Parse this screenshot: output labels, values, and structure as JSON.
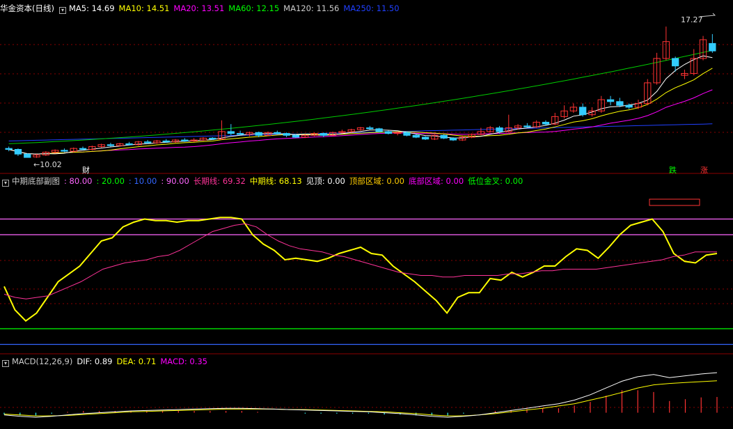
{
  "stock_title": "华金资本(日线)",
  "legend_ma": [
    {
      "label": "MA5: 14.69",
      "color": "#ffffff"
    },
    {
      "label": "MA10: 14.51",
      "color": "#ffff00"
    },
    {
      "label": "MA20: 13.51",
      "color": "#ff00ff"
    },
    {
      "label": "MA60: 12.15",
      "color": "#00ff00"
    },
    {
      "label": "MA120: 11.56",
      "color": "#cccccc"
    },
    {
      "label": "MA250: 11.50",
      "color": "#2040ff"
    }
  ],
  "price_high_label": "17.27",
  "price_low_label": "←10.02",
  "marker_cai": "财",
  "marker_die": "跌",
  "marker_zhang": "涨",
  "legend_mid": [
    {
      "label": "中期底部副图",
      "color": "#cccccc"
    },
    {
      "label": ": 80.00",
      "color": "#ff66ff"
    },
    {
      "label": ": 20.00",
      "color": "#00ff00"
    },
    {
      "label": ": 10.00",
      "color": "#3366ff"
    },
    {
      "label": ": 90.00",
      "color": "#ff66ff"
    },
    {
      "label": "长期线: 69.32",
      "color": "#ff3399"
    },
    {
      "label": "中期线: 68.13",
      "color": "#ffff00"
    },
    {
      "label": "见顶: 0.00",
      "color": "#ffffff"
    },
    {
      "label": "顶部区域: 0.00",
      "color": "#ffcc00"
    },
    {
      "label": "底部区域: 0.00",
      "color": "#ff00ff"
    },
    {
      "label": "低位金叉: 0.00",
      "color": "#00ff00"
    }
  ],
  "legend_macd": [
    {
      "label": "MACD(12,26,9)",
      "color": "#cccccc"
    },
    {
      "label": "DIF: 0.89",
      "color": "#ffffff"
    },
    {
      "label": "DEA: 0.71",
      "color": "#ffff00"
    },
    {
      "label": "MACD: 0.35",
      "color": "#ff00ff"
    }
  ],
  "colors": {
    "up": "#ff3333",
    "down": "#33ccff",
    "grid": "#8b0000"
  },
  "chart_data": [
    {
      "type": "candlestick",
      "title": "华金资本(日线)",
      "ylim": [
        9.8,
        17.6
      ],
      "candles": [
        [
          10.5,
          10.45,
          10.6,
          10.35
        ],
        [
          10.45,
          10.2,
          10.5,
          10.1
        ],
        [
          10.2,
          10.02,
          10.25,
          10.02
        ],
        [
          10.05,
          10.15,
          10.2,
          10.0
        ],
        [
          10.15,
          10.3,
          10.35,
          10.1
        ],
        [
          10.3,
          10.4,
          10.45,
          10.25
        ],
        [
          10.4,
          10.35,
          10.5,
          10.3
        ],
        [
          10.35,
          10.5,
          10.55,
          10.3
        ],
        [
          10.5,
          10.45,
          10.6,
          10.4
        ],
        [
          10.45,
          10.6,
          10.65,
          10.4
        ],
        [
          10.6,
          10.7,
          10.75,
          10.55
        ],
        [
          10.7,
          10.65,
          10.8,
          10.6
        ],
        [
          10.65,
          10.75,
          10.8,
          10.6
        ],
        [
          10.75,
          10.7,
          10.85,
          10.65
        ],
        [
          10.7,
          10.85,
          10.9,
          10.65
        ],
        [
          10.85,
          10.8,
          10.95,
          10.75
        ],
        [
          10.8,
          10.9,
          10.95,
          10.75
        ],
        [
          10.9,
          10.85,
          11.0,
          10.8
        ],
        [
          10.85,
          10.95,
          11.0,
          10.8
        ],
        [
          10.95,
          10.9,
          11.05,
          10.85
        ],
        [
          10.9,
          10.95,
          11.05,
          10.85
        ],
        [
          10.95,
          11.05,
          11.1,
          10.9
        ],
        [
          11.05,
          11.0,
          11.1,
          10.95
        ],
        [
          11.0,
          11.4,
          12.0,
          10.95
        ],
        [
          11.4,
          11.3,
          11.8,
          11.2
        ],
        [
          11.3,
          11.25,
          11.45,
          11.2
        ],
        [
          11.25,
          11.35,
          11.4,
          11.15
        ],
        [
          11.35,
          11.2,
          11.4,
          11.1
        ],
        [
          11.2,
          11.35,
          11.4,
          11.15
        ],
        [
          11.35,
          11.3,
          11.45,
          11.25
        ],
        [
          11.3,
          11.2,
          11.35,
          11.1
        ],
        [
          11.2,
          11.1,
          11.25,
          11.05
        ],
        [
          11.1,
          11.2,
          11.25,
          11.05
        ],
        [
          11.2,
          11.3,
          11.35,
          11.15
        ],
        [
          11.3,
          11.2,
          11.35,
          11.1
        ],
        [
          11.2,
          11.35,
          11.4,
          11.15
        ],
        [
          11.35,
          11.4,
          11.5,
          11.3
        ],
        [
          11.4,
          11.5,
          11.55,
          11.35
        ],
        [
          11.5,
          11.6,
          11.65,
          11.45
        ],
        [
          11.6,
          11.55,
          11.7,
          11.5
        ],
        [
          11.55,
          11.4,
          11.6,
          11.35
        ],
        [
          11.4,
          11.3,
          11.45,
          11.25
        ],
        [
          11.3,
          11.35,
          11.4,
          11.2
        ],
        [
          11.35,
          11.2,
          11.4,
          11.15
        ],
        [
          11.2,
          11.1,
          11.25,
          11.05
        ],
        [
          11.1,
          11.0,
          11.15,
          10.95
        ],
        [
          11.0,
          11.2,
          11.25,
          10.95
        ],
        [
          11.2,
          11.05,
          11.25,
          11.0
        ],
        [
          11.05,
          10.95,
          11.1,
          10.9
        ],
        [
          10.95,
          11.1,
          11.2,
          10.9
        ],
        [
          11.1,
          11.25,
          11.3,
          11.05
        ],
        [
          11.25,
          11.4,
          11.6,
          11.2
        ],
        [
          11.4,
          11.6,
          11.7,
          11.35
        ],
        [
          11.6,
          11.4,
          11.7,
          11.3
        ],
        [
          11.4,
          11.6,
          12.3,
          11.35
        ],
        [
          11.6,
          11.7,
          11.8,
          11.5
        ],
        [
          11.7,
          11.65,
          11.85,
          11.6
        ],
        [
          11.65,
          11.9,
          12.0,
          11.6
        ],
        [
          11.9,
          11.8,
          12.0,
          11.7
        ],
        [
          11.8,
          12.2,
          12.4,
          11.75
        ],
        [
          12.2,
          12.5,
          12.8,
          12.1
        ],
        [
          12.5,
          12.7,
          12.9,
          12.4
        ],
        [
          12.7,
          12.3,
          12.9,
          12.2
        ],
        [
          12.3,
          12.5,
          12.7,
          12.2
        ],
        [
          12.5,
          13.1,
          13.3,
          12.4
        ],
        [
          13.1,
          13.0,
          13.3,
          12.8
        ],
        [
          13.0,
          12.8,
          13.2,
          12.7
        ],
        [
          12.8,
          12.7,
          12.9,
          12.6
        ],
        [
          12.7,
          12.9,
          13.1,
          12.6
        ],
        [
          12.9,
          14.0,
          14.2,
          12.8
        ],
        [
          14.0,
          15.3,
          15.6,
          13.9
        ],
        [
          15.3,
          16.2,
          17.0,
          15.2
        ],
        [
          15.3,
          14.9,
          15.4,
          14.6
        ],
        [
          14.4,
          14.5,
          14.7,
          14.2
        ],
        [
          14.5,
          15.3,
          15.8,
          14.4
        ],
        [
          15.3,
          16.3,
          16.5,
          15.2
        ],
        [
          16.1,
          15.7,
          16.6,
          15.6
        ]
      ]
    },
    {
      "type": "line",
      "title": "中期底部副图",
      "ylim": [
        0,
        100
      ],
      "reference_lines": [
        {
          "value": 90,
          "color": "#ff66ff"
        },
        {
          "value": 80,
          "color": "#ff66ff"
        },
        {
          "value": 20,
          "color": "#00ff00"
        },
        {
          "value": 10,
          "color": "#3366ff"
        }
      ],
      "series": [
        {
          "name": "中期线",
          "color": "#ffff00",
          "values": [
            47,
            32,
            25,
            30,
            40,
            50,
            55,
            60,
            68,
            76,
            78,
            85,
            88,
            90,
            89,
            89,
            88,
            89,
            89,
            90,
            91,
            91,
            90,
            80,
            74,
            70,
            64,
            65,
            64,
            63,
            65,
            68,
            70,
            72,
            68,
            67,
            60,
            55,
            50,
            44,
            38,
            30,
            40,
            43,
            43,
            52,
            51,
            56,
            53,
            56,
            60,
            60,
            66,
            71,
            70,
            65,
            72,
            80,
            86,
            88,
            90,
            82,
            68,
            63,
            62,
            67,
            68
          ]
        },
        {
          "name": "长期线",
          "color": "#ff3399",
          "values": [
            42,
            40,
            39,
            40,
            41,
            44,
            47,
            50,
            54,
            58,
            60,
            62,
            63,
            64,
            66,
            67,
            70,
            74,
            78,
            82,
            84,
            86,
            87,
            85,
            80,
            76,
            73,
            71,
            70,
            69,
            67,
            66,
            64,
            62,
            60,
            58,
            56,
            55,
            54,
            54,
            53,
            53,
            54,
            54,
            54,
            54,
            55,
            55,
            56,
            57,
            57,
            58,
            58,
            58,
            58,
            59,
            60,
            61,
            62,
            63,
            64,
            66,
            67,
            69,
            69,
            69
          ]
        }
      ]
    },
    {
      "type": "line",
      "title": "MACD(12,26,9)",
      "ylim": [
        -0.3,
        1.0
      ],
      "series": [
        {
          "name": "DIF",
          "color": "#ffffff",
          "values": [
            -0.05,
            -0.08,
            -0.1,
            -0.08,
            -0.05,
            -0.02,
            0.0,
            0.02,
            0.04,
            0.05,
            0.06,
            0.07,
            0.08,
            0.09,
            0.1,
            0.1,
            0.09,
            0.08,
            0.07,
            0.06,
            0.05,
            0.04,
            0.03,
            0.02,
            0.0,
            -0.02,
            -0.05,
            -0.08,
            -0.1,
            -0.08,
            -0.05,
            0.0,
            0.05,
            0.1,
            0.15,
            0.2,
            0.28,
            0.4,
            0.55,
            0.7,
            0.8,
            0.85,
            0.78,
            0.82,
            0.86,
            0.89
          ]
        },
        {
          "name": "DEA",
          "color": "#ffff00",
          "values": [
            -0.03,
            -0.05,
            -0.07,
            -0.07,
            -0.06,
            -0.04,
            -0.02,
            0.0,
            0.02,
            0.03,
            0.04,
            0.05,
            0.06,
            0.07,
            0.08,
            0.08,
            0.08,
            0.08,
            0.07,
            0.07,
            0.06,
            0.05,
            0.04,
            0.03,
            0.02,
            0.0,
            -0.02,
            -0.05,
            -0.07,
            -0.07,
            -0.05,
            -0.02,
            0.02,
            0.06,
            0.1,
            0.15,
            0.2,
            0.28,
            0.36,
            0.45,
            0.55,
            0.62,
            0.65,
            0.67,
            0.69,
            0.71
          ]
        },
        {
          "name": "MACD",
          "color": "#ff00ff",
          "values": [
            -0.04,
            -0.06,
            -0.06,
            -0.02,
            0.02,
            0.04,
            0.04,
            0.04,
            0.04,
            0.04,
            0.04,
            0.04,
            0.04,
            0.04,
            0.04,
            0.04,
            0.02,
            0.0,
            0.0,
            -0.02,
            -0.02,
            -0.02,
            -0.02,
            -0.02,
            -0.04,
            -0.04,
            -0.06,
            -0.06,
            -0.06,
            -0.02,
            0.0,
            0.04,
            0.06,
            0.08,
            0.1,
            0.1,
            0.16,
            0.24,
            0.38,
            0.5,
            0.5,
            0.46,
            0.26,
            0.3,
            0.34,
            0.35
          ]
        }
      ]
    }
  ]
}
